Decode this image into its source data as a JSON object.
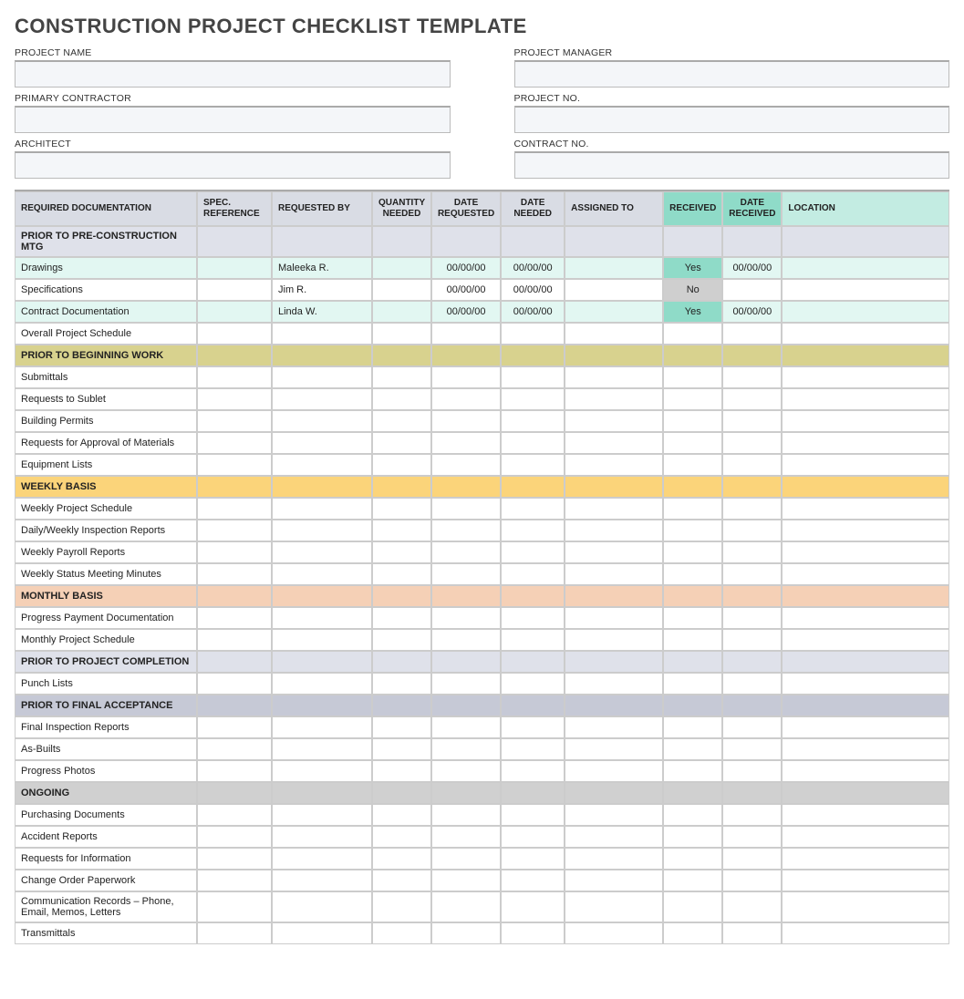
{
  "title": "CONSTRUCTION PROJECT CHECKLIST TEMPLATE",
  "info": {
    "project_name_label": "PROJECT NAME",
    "project_manager_label": "PROJECT MANAGER",
    "primary_contractor_label": "PRIMARY CONTRACTOR",
    "project_no_label": "PROJECT NO.",
    "architect_label": "ARCHITECT",
    "contract_no_label": "CONTRACT NO."
  },
  "columns": {
    "doc": "REQUIRED DOCUMENTATION",
    "spec": "SPEC. REFERENCE",
    "requested_by": "REQUESTED BY",
    "qty": "QUANTITY NEEDED",
    "date_req": "DATE REQUESTED",
    "date_need": "DATE NEEDED",
    "assigned": "ASSIGNED TO",
    "received": "RECEIVED",
    "date_recv": "DATE RECEIVED",
    "location": "LOCATION"
  },
  "sections": [
    {
      "name": "PRIOR TO PRE-CONSTRUCTION MTG",
      "class": "section-preconstruction",
      "rows": [
        {
          "doc": "Drawings",
          "requested_by": "Maleeka R.",
          "date_req": "00/00/00",
          "date_need": "00/00/00",
          "received": "Yes",
          "date_recv": "00/00/00",
          "row_class": "row-teal"
        },
        {
          "doc": "Specifications",
          "requested_by": "Jim R.",
          "date_req": "00/00/00",
          "date_need": "00/00/00",
          "received": "No"
        },
        {
          "doc": "Contract Documentation",
          "requested_by": "Linda W.",
          "date_req": "00/00/00",
          "date_need": "00/00/00",
          "received": "Yes",
          "date_recv": "00/00/00",
          "row_class": "row-teal"
        },
        {
          "doc": "Overall Project Schedule"
        }
      ]
    },
    {
      "name": "PRIOR TO BEGINNING WORK",
      "class": "section-beginning",
      "rows": [
        {
          "doc": "Submittals"
        },
        {
          "doc": "Requests to Sublet"
        },
        {
          "doc": "Building Permits"
        },
        {
          "doc": "Requests for Approval of Materials"
        },
        {
          "doc": "Equipment Lists"
        }
      ]
    },
    {
      "name": "WEEKLY BASIS",
      "class": "section-weekly",
      "rows": [
        {
          "doc": "Weekly Project Schedule"
        },
        {
          "doc": "Daily/Weekly Inspection Reports"
        },
        {
          "doc": "Weekly Payroll Reports"
        },
        {
          "doc": "Weekly Status Meeting Minutes"
        }
      ]
    },
    {
      "name": "MONTHLY BASIS",
      "class": "section-monthly",
      "rows": [
        {
          "doc": "Progress Payment Documentation"
        },
        {
          "doc": "Monthly Project Schedule"
        }
      ]
    },
    {
      "name": "PRIOR TO PROJECT COMPLETION",
      "class": "section-completion",
      "rows": [
        {
          "doc": "Punch Lists"
        }
      ]
    },
    {
      "name": "PRIOR TO FINAL ACCEPTANCE",
      "class": "section-final",
      "rows": [
        {
          "doc": "Final Inspection Reports"
        },
        {
          "doc": "As-Builts"
        },
        {
          "doc": "Progress Photos"
        }
      ]
    },
    {
      "name": "ONGOING",
      "class": "section-ongoing",
      "rows": [
        {
          "doc": "Purchasing Documents"
        },
        {
          "doc": "Accident Reports"
        },
        {
          "doc": "Requests for Information"
        },
        {
          "doc": "Change Order Paperwork"
        },
        {
          "doc": "Communication Records – Phone, Email, Memos, Letters"
        },
        {
          "doc": "Transmittals"
        }
      ]
    }
  ]
}
